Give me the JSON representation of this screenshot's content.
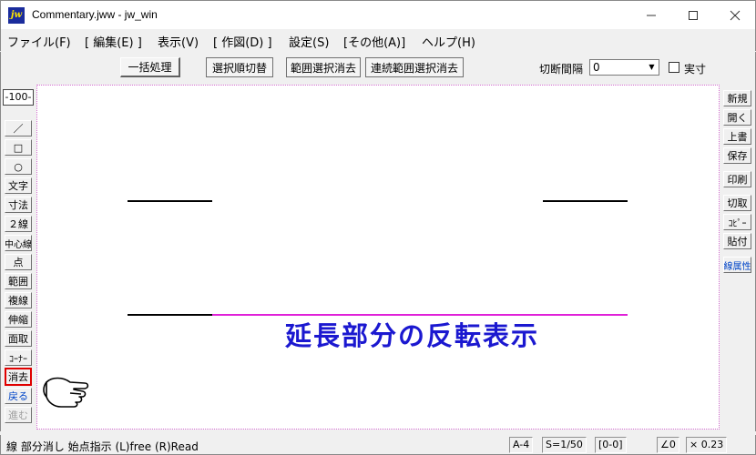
{
  "window": {
    "icon_text": "jw",
    "title": "Commentary.jww - jw_win"
  },
  "menu": [
    {
      "label": "ファイル(F)"
    },
    {
      "label": "[ 編集(E) ]"
    },
    {
      "label": "表示(V)"
    },
    {
      "label": "[ 作図(D) ]"
    },
    {
      "label": "設定(S)"
    },
    {
      "label": "[その他(A)]"
    },
    {
      "label": "ヘルプ(H)"
    }
  ],
  "toolbar": {
    "buttons": [
      {
        "label": "一括処理"
      },
      {
        "label": "選択順切替"
      },
      {
        "label": "範囲選択消去"
      },
      {
        "label": "連続範囲選択消去"
      }
    ],
    "cut_interval_label": "切断間隔",
    "cut_interval_value": "0",
    "actual_size_label": "実寸"
  },
  "left_tools": {
    "scale_label": "-100-",
    "items": [
      {
        "label": "／",
        "name": "line-tool"
      },
      {
        "label": "□",
        "name": "rectangle-tool"
      },
      {
        "label": "○",
        "name": "circle-tool"
      },
      {
        "label": "文字",
        "name": "text-tool"
      },
      {
        "label": "寸法",
        "name": "dimension-tool"
      },
      {
        "label": "２線",
        "name": "double-line-tool"
      },
      {
        "label": "中心線",
        "name": "center-line-tool"
      },
      {
        "label": "点",
        "name": "point-tool"
      },
      {
        "label": "範囲",
        "name": "range-tool"
      },
      {
        "label": "複線",
        "name": "parallel-line-tool"
      },
      {
        "label": "伸縮",
        "name": "stretch-tool"
      },
      {
        "label": "面取",
        "name": "chamfer-tool"
      },
      {
        "label": "ｺｰﾅｰ",
        "name": "corner-tool"
      },
      {
        "label": "消去",
        "name": "erase-tool"
      },
      {
        "label": "戻る",
        "name": "undo-tool"
      },
      {
        "label": "進む",
        "name": "redo-tool"
      }
    ]
  },
  "right_tools": {
    "items": [
      {
        "label": "新規",
        "name": "new-file-button"
      },
      {
        "label": "開く",
        "name": "open-file-button"
      },
      {
        "label": "上書",
        "name": "overwrite-button"
      },
      {
        "label": "保存",
        "name": "save-button"
      },
      {
        "label": "印刷",
        "name": "print-button"
      },
      {
        "label": "切取",
        "name": "cut-button"
      },
      {
        "label": "ｺﾋﾟｰ",
        "name": "copy-button"
      },
      {
        "label": "貼付",
        "name": "paste-button"
      },
      {
        "label": "線属性",
        "name": "line-attribute-button"
      }
    ]
  },
  "canvas": {
    "annotation_text": "延長部分の反転表示",
    "annotation_color": "#1b18d0",
    "highlight_color": "#e020d8",
    "line_color": "#000000"
  },
  "status": {
    "message": "線 部分消し 始点指示 (L)free (R)Read",
    "paper": "A-4",
    "scale": "S=1/50",
    "layer": "[0-0]",
    "angle": "∠0",
    "factor": "× 0.23"
  },
  "colors": {
    "selected_tool_border": "#e00000",
    "blue_text": "#0045c8"
  }
}
